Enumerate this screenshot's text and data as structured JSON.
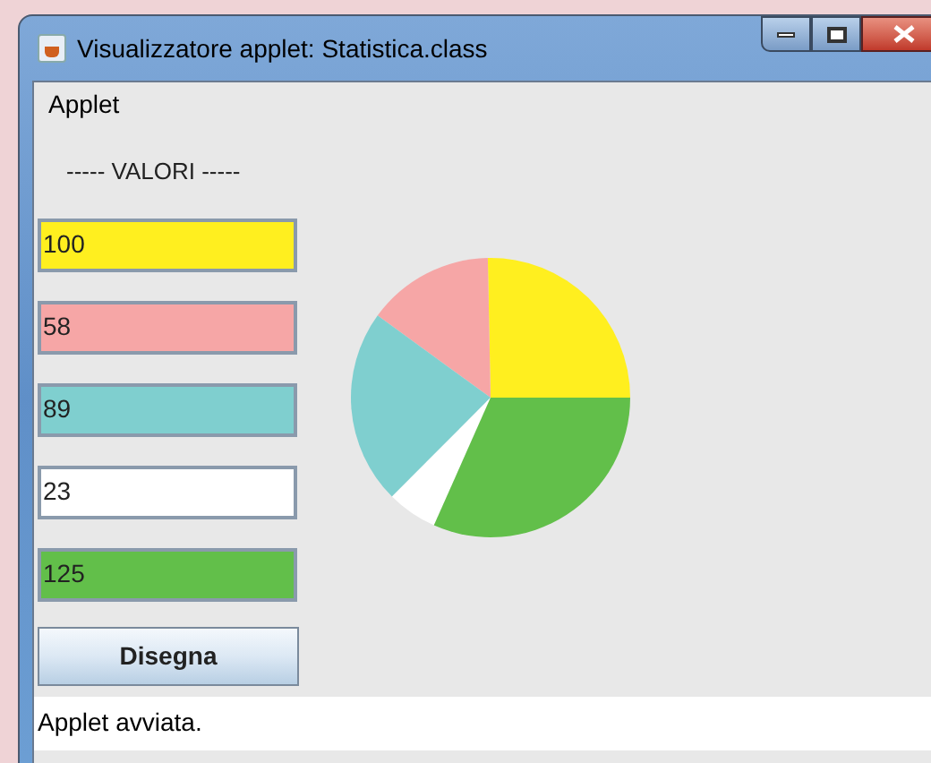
{
  "window": {
    "title": "Visualizzatore applet: Statistica.class"
  },
  "menu": [
    "Applet"
  ],
  "heading": "----- VALORI -----",
  "fields": [
    {
      "value": "100",
      "color": "#ffef1f"
    },
    {
      "value": "58",
      "color": "#f6a6a6"
    },
    {
      "value": "89",
      "color": "#7fcfcf"
    },
    {
      "value": "23",
      "color": "#ffffff"
    },
    {
      "value": "125",
      "color": "#62bf4a"
    }
  ],
  "button": "Disegna",
  "status_bar": "Applet avviata."
}
